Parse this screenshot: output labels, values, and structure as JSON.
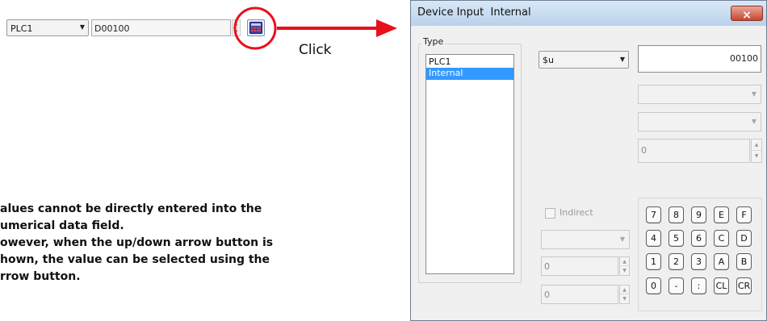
{
  "left_bar": {
    "plc_select": "PLC1",
    "address_value": "D00100"
  },
  "click_label": "Click",
  "notes": [
    "alues cannot be directly entered into the",
    "umerical data field.",
    "owever, when the up/down arrow button is",
    "hown, the value can be selected using the",
    "rrow button."
  ],
  "dialog": {
    "title": "Device Input  Internal",
    "close_glyph": "×",
    "type_group_label": "Type",
    "type_items": [
      "PLC1",
      "Internal"
    ],
    "device_select": "$u",
    "address_value": "00100",
    "numeric_value": "0",
    "indirect_label": "Indirect",
    "indirect_value_1": "0",
    "indirect_value_2": "0",
    "keypad": [
      [
        "7",
        "8",
        "9",
        "E",
        "F"
      ],
      [
        "4",
        "5",
        "6",
        "C",
        "D"
      ],
      [
        "1",
        "2",
        "3",
        "A",
        "B"
      ],
      [
        "0",
        "-",
        ":",
        "CL",
        "CR"
      ]
    ]
  },
  "colors": {
    "annotation_red": "#e8101a",
    "title_gradient_top": "#cfe3f7",
    "selection": "#3399ff"
  }
}
